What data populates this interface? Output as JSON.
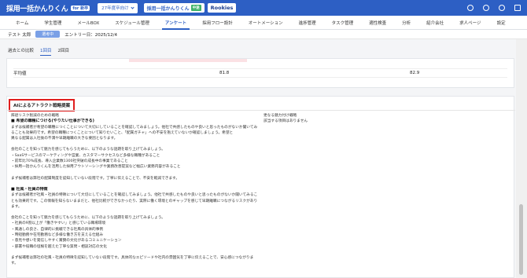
{
  "header": {
    "logo_text": "採用一括かんりくん",
    "logo_tag": "for 新卒",
    "year_select": "27年度卒向け",
    "brand2_text": "採用一括かんりくん",
    "brand2_tag": "中途",
    "brand3_text": "Rookies"
  },
  "nav": {
    "items": [
      {
        "label": "ホーム"
      },
      {
        "label": "学生管理"
      },
      {
        "label": "メールBOX"
      },
      {
        "label": "スケジュール管理"
      },
      {
        "label": "アンケート"
      },
      {
        "label": "採用フロー設計"
      },
      {
        "label": "オートメーション"
      },
      {
        "label": "進捗管理"
      },
      {
        "label": "タスク管理"
      },
      {
        "label": "適性検査"
      },
      {
        "label": "分析"
      },
      {
        "label": "紹介会社"
      },
      {
        "label": "求人ページ"
      },
      {
        "label": "設定"
      }
    ],
    "active_index": 4
  },
  "applicant": {
    "name": "テスト 太郎",
    "status": "選考中",
    "entry_date": "エントリー日：2025/12/4"
  },
  "tabs": {
    "compare": "過去との比較",
    "round1": "1回目",
    "round2": "2回目"
  },
  "score": {
    "label": "平均値",
    "value1": "81.8",
    "value2": "82.9"
  },
  "ai": {
    "title": "AIによるアトラクト戦略提案",
    "left": {
      "subtitle": "辞退リスク削減のための戦略",
      "section1_head": "■ 希望の職種につける(やりたい仕事ができる)",
      "section1_lines": [
        "まずは候補者が希望の職種につくことについて大切にしていることを確認してみましょう。他社で共感したものや良いと思ったものがないか聞いてみ",
        "ることも効果的です。希望の職種につくことについて知りたいこと、「配属ガチャ」への不安を抱えていないか確認しましょう。希望と",
        "異なる配属は入社後の不満や早期離職の大きな要因となります。"
      ],
      "section1_lines2": [
        "会社のことを知って魅力を感じてもらうために、以下のような話題を取り上げてみましょう。",
        "・SaaSサービスのマーケティングや営業、カスタマーサクセスなど多様な職種があること",
        "・前年比70%成長、導入企業数1300社突破の成長中の事業であること",
        "・採用一括かんりくんを活用した採用アウトソーシングや業務改善提案など幅広い業務内容があること"
      ],
      "section1_close": "まず候補者は弊社の配属制度を認知していない段階です。丁寧に伝えることで、不安を軽減できます。",
      "section2_head": "■ 社風・社員の特徴",
      "section2_lines": [
        "まずは候補者が社風・社員の特徴について大切にしていることを確認してみましょう。他社で共感したものや良いと思ったものがないか聞いてみるこ",
        "とも効果的です。この情報を知らないままだと、他社比較ができなかったり、実際に働く環境とのギャップを感じて早期離職につながるリスクがあり",
        "ます。"
      ],
      "section2_lines2": [
        "会社のことを知って魅力を感じてもらうために、以下のような話題を取り上げてみましょう。",
        "・社員の9割以上が「働きやすい」と感じている職場環境",
        "・風通しの良さ、自律的に挑戦できる社風の具体的事例",
        "・時短勤務や在宅勤務など多様な働き方を支える仕組み",
        "・意見や想いを発信しやすく賞賛の文化があるコミュニケーション",
        "・部署や役職の垣根を越えた丁寧な質問・相談対応の文化"
      ],
      "section2_close": "まず候補者は弊社の社風・社員の特徴を認知していない段階です。具体的なエピソードや社内の雰囲気を丁寧に伝えることで、安心感につながりま",
      "section2_close2": "す。"
    },
    "right": {
      "subtitle": "更なる魅力付け戦略",
      "text": "該当する項目はありません"
    }
  }
}
